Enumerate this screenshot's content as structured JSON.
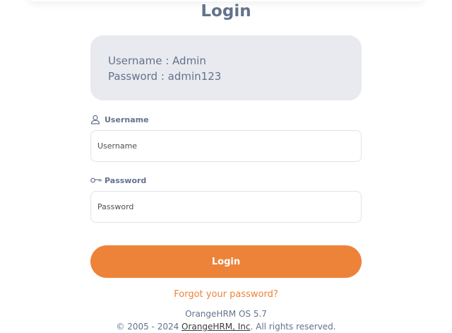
{
  "title": "Login",
  "credentials": {
    "username_line": "Username : Admin",
    "password_line": "Password : admin123"
  },
  "username": {
    "label": "Username",
    "placeholder": "Username",
    "icon": "user-icon"
  },
  "password": {
    "label": "Password",
    "placeholder": "Password",
    "icon": "key-icon"
  },
  "login_button": "Login",
  "forgot_link": "Forgot your password?",
  "footer": {
    "version": "OrangeHRM OS 5.7",
    "copyright_prefix": "© 2005 - 2024 ",
    "company_link": "OrangeHRM, Inc",
    "copyright_suffix": ". All rights reserved."
  },
  "colors": {
    "accent": "#ed8339",
    "text": "#64728c",
    "credentials_bg": "#e8eaef"
  }
}
